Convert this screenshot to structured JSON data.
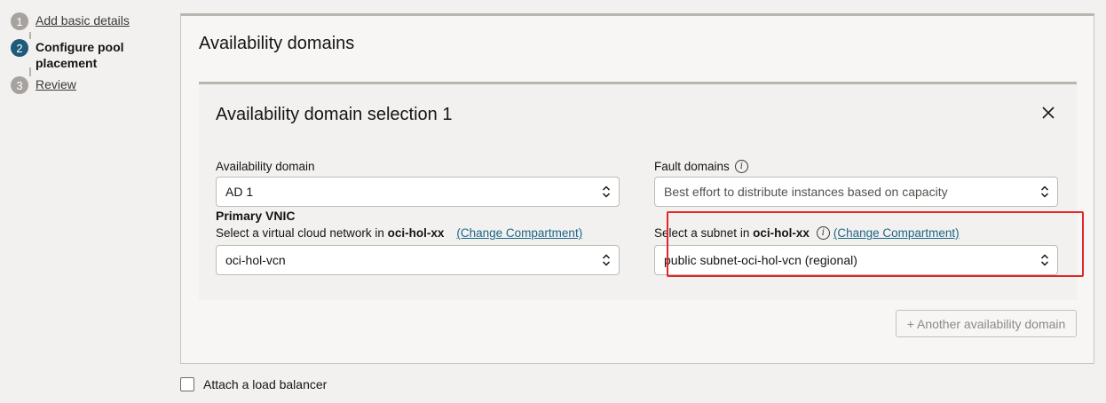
{
  "steps": [
    {
      "number": "1",
      "label": "Add basic details",
      "state": "link"
    },
    {
      "number": "2",
      "label": "Configure pool placement",
      "state": "current"
    },
    {
      "number": "3",
      "label": "Review",
      "state": "link"
    }
  ],
  "panel": {
    "title": "Availability domains",
    "ad_card": {
      "title": "Availability domain selection 1",
      "availability_domain": {
        "label": "Availability domain",
        "value": "AD 1"
      },
      "fault_domains": {
        "label": "Fault domains",
        "value": "Best effort to distribute instances based on capacity"
      },
      "primary_vnic": {
        "heading": "Primary VNIC",
        "vcn_label_prefix": "Select a virtual cloud network in",
        "vcn_compartment": "oci-hol-xx",
        "vcn_change_link": "(Change Compartment)",
        "vcn_value": "oci-hol-vcn",
        "subnet_label_prefix": "Select a subnet in",
        "subnet_compartment": "oci-hol-xx",
        "subnet_change_link": "(Change Compartment)",
        "subnet_value": "public subnet-oci-hol-vcn (regional)"
      }
    },
    "add_ad_button": "+ Another availability domain"
  },
  "load_balancer": {
    "label": "Attach a load balancer",
    "checked": false
  },
  "colors": {
    "accent": "#1f5a7a",
    "link": "#1e6587",
    "highlight": "#e0272a"
  }
}
